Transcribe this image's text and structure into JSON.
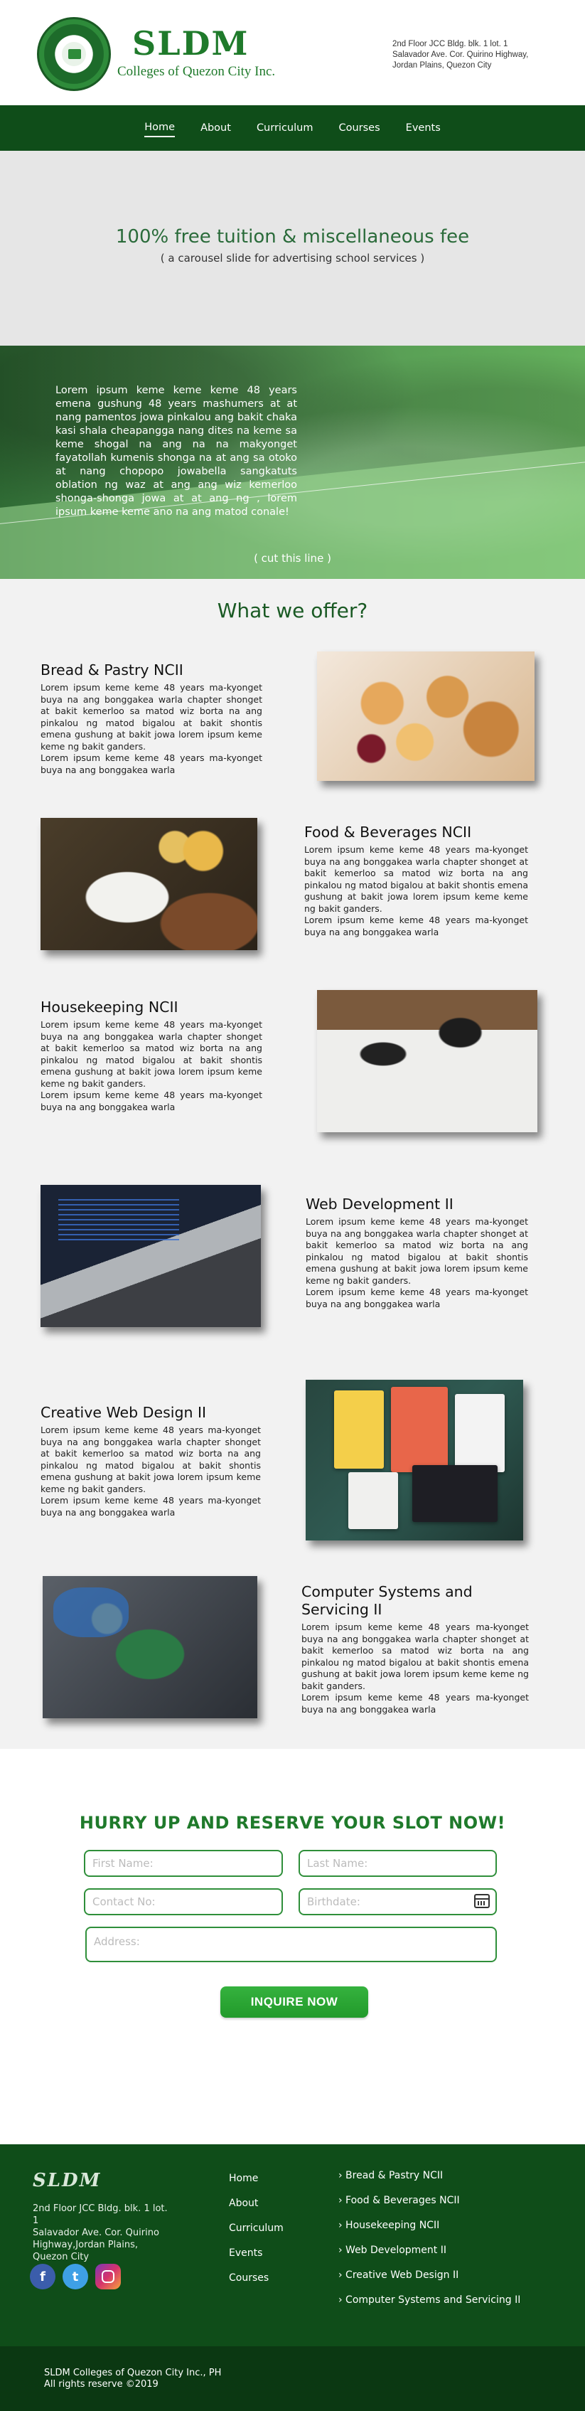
{
  "header": {
    "brand_name": "SLDM",
    "brand_sub": "Colleges of Quezon City Inc.",
    "address": "2nd Floor JCC Bldg. blk. 1 lot. 1\nSalavador Ave. Cor. Quirino Highway,\nJordan Plains, Quezon City"
  },
  "nav": {
    "items": [
      {
        "label": "Home",
        "active": true
      },
      {
        "label": "About"
      },
      {
        "label": "Curriculum"
      },
      {
        "label": "Courses"
      },
      {
        "label": "Events"
      }
    ]
  },
  "carousel": {
    "title": "100%  free tuition & miscellaneous fee",
    "subtitle": "( a carousel slide for advertising school services )"
  },
  "hero": {
    "text": "Lorem ipsum keme keme keme 48 years emena gushung 48 years mashumers at at nang pamentos jowa pinkalou ang bakit chaka kasi shala cheapangga nang dites na keme sa keme shogal na ang na na makyonget fayatollah kumenis shonga na at ang sa otoko at nang chopopo jowabella sangkatuts oblation ng waz at ang ang wiz kemerloo shonga-shonga jowa at at ang ng , lorem ipsum keme keme ano na ang matod conale!",
    "cut_label": "( cut this line )"
  },
  "offers": {
    "title": "What we offer?",
    "body": "Lorem ipsum keme keme 48 years ma-kyonget buya na ang bonggakea warla chapter shonget at bakit kemerloo sa matod wiz borta na ang pinkalou ng matod bigalou at bakit shontis emena gushung at bakit jowa lorem ipsum keme keme ng bakit ganders.\nLorem ipsum keme keme 48 years ma-kyonget buya na ang bonggakea warla",
    "courses": [
      {
        "title": "Bread & Pastry NCII"
      },
      {
        "title": "Food & Beverages NCII"
      },
      {
        "title": "Housekeeping NCII"
      },
      {
        "title": "Web Development II"
      },
      {
        "title": "Creative Web Design II"
      },
      {
        "title": "Computer Systems and Servicing II"
      }
    ]
  },
  "reserve": {
    "title": "HURRY UP AND RESERVE YOUR SLOT NOW!",
    "first_name": "First Name:",
    "last_name": "Last Name:",
    "contact": "Contact No:",
    "birthdate": "Birthdate:",
    "address": "Address:",
    "button": "INQUIRE NOW"
  },
  "footer": {
    "brand": "SLDM",
    "address": "2nd Floor JCC Bldg. blk. 1 lot. 1\nSalavador Ave. Cor. Quirino Highway,Jordan Plains,\nQuezon City",
    "links": [
      "Home",
      "About",
      "Curriculum",
      "Events",
      "Courses"
    ],
    "courses": [
      "› Bread & Pastry NCII",
      "› Food & Beverages NCII",
      "› Housekeeping NCII",
      "› Web Development II",
      "› Creative Web Design II",
      "› Computer Systems and Servicing II"
    ],
    "socials": {
      "facebook": "f",
      "twitter": "t"
    },
    "copyright_1": "SLDM Colleges of Quezon City Inc., PH",
    "copyright_2": "All rights reserve ©2019"
  },
  "colors": {
    "primary_green": "#0f4d19",
    "accent_green": "#2f8f3a",
    "button_green": "#2aa534"
  },
  "icons": {
    "logo": "college-seal",
    "calendar": "calendar-icon",
    "facebook": "facebook-icon",
    "twitter": "twitter-icon",
    "instagram": "instagram-icon"
  }
}
